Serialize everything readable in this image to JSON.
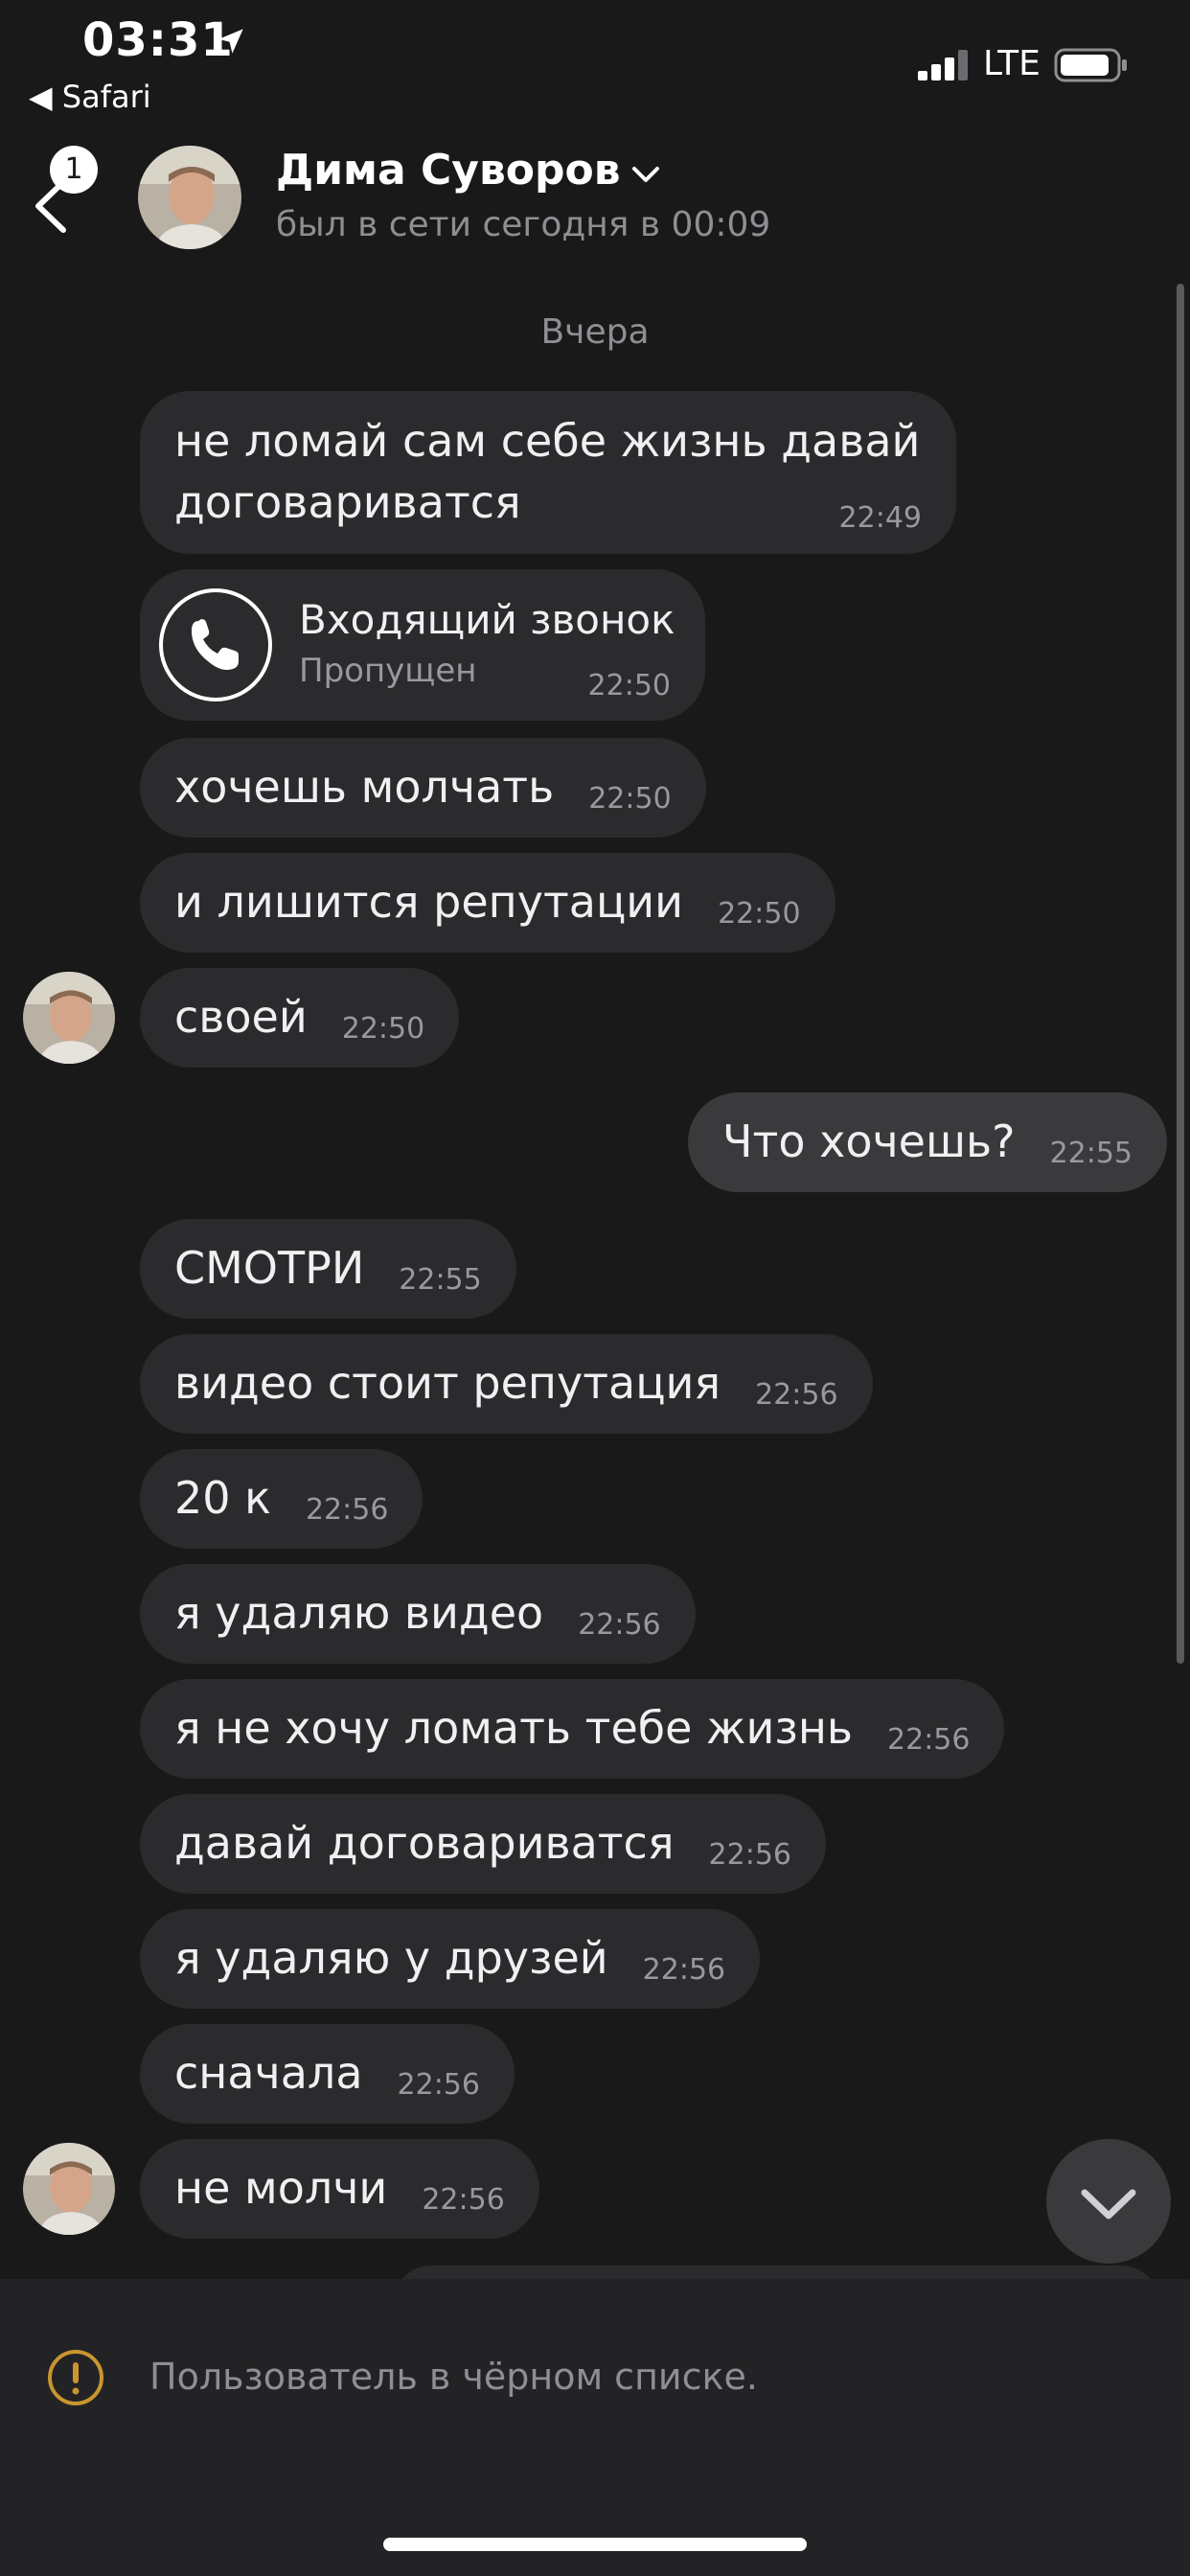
{
  "status_bar": {
    "time": "03:31",
    "back_app": "◀ Safari",
    "network": "LTE"
  },
  "header": {
    "unread_count": "1",
    "contact_name": "Дима Суворов",
    "last_seen": "был в сети сегодня в 00:09"
  },
  "date_separator": "Вчера",
  "messages": [
    {
      "text": "не ломай сам себе жизнь давай договариватся",
      "time": "22:49"
    },
    {
      "call_title": "Входящий звонок",
      "call_status": "Пропущен",
      "time": "22:50"
    },
    {
      "text": "хочешь молчать",
      "time": "22:50"
    },
    {
      "text": "и лишится репутации",
      "time": "22:50"
    },
    {
      "text": "своей",
      "time": "22:50"
    },
    {
      "text": "Что хочешь?",
      "time": "22:55"
    },
    {
      "text": "СМОТРИ",
      "time": "22:55"
    },
    {
      "text": "видео стоит репутация",
      "time": "22:56"
    },
    {
      "text": "20 к",
      "time": "22:56"
    },
    {
      "text": "я удаляю видео",
      "time": "22:56"
    },
    {
      "text": "я не хочу ломать тебе жизнь",
      "time": "22:56"
    },
    {
      "text": "давай договариватся",
      "time": "22:56"
    },
    {
      "text": "я удаляю у друзей",
      "time": "22:56"
    },
    {
      "text": "сначала",
      "time": "22:56"
    },
    {
      "text": "не молчи",
      "time": "22:56"
    }
  ],
  "footer": {
    "blocked_notice": "Пользователь в чёрном списке."
  },
  "colors": {
    "background": "#19191a",
    "incoming_bubble": "#2b2b2d",
    "outgoing_bubble": "#3a3a3c",
    "warning": "#c9952e"
  },
  "icons": [
    "location-arrow-icon",
    "signal-icon",
    "battery-icon",
    "back-chevron-icon",
    "chevron-down-icon",
    "phone-icon",
    "chevron-down-icon",
    "warning-icon"
  ]
}
